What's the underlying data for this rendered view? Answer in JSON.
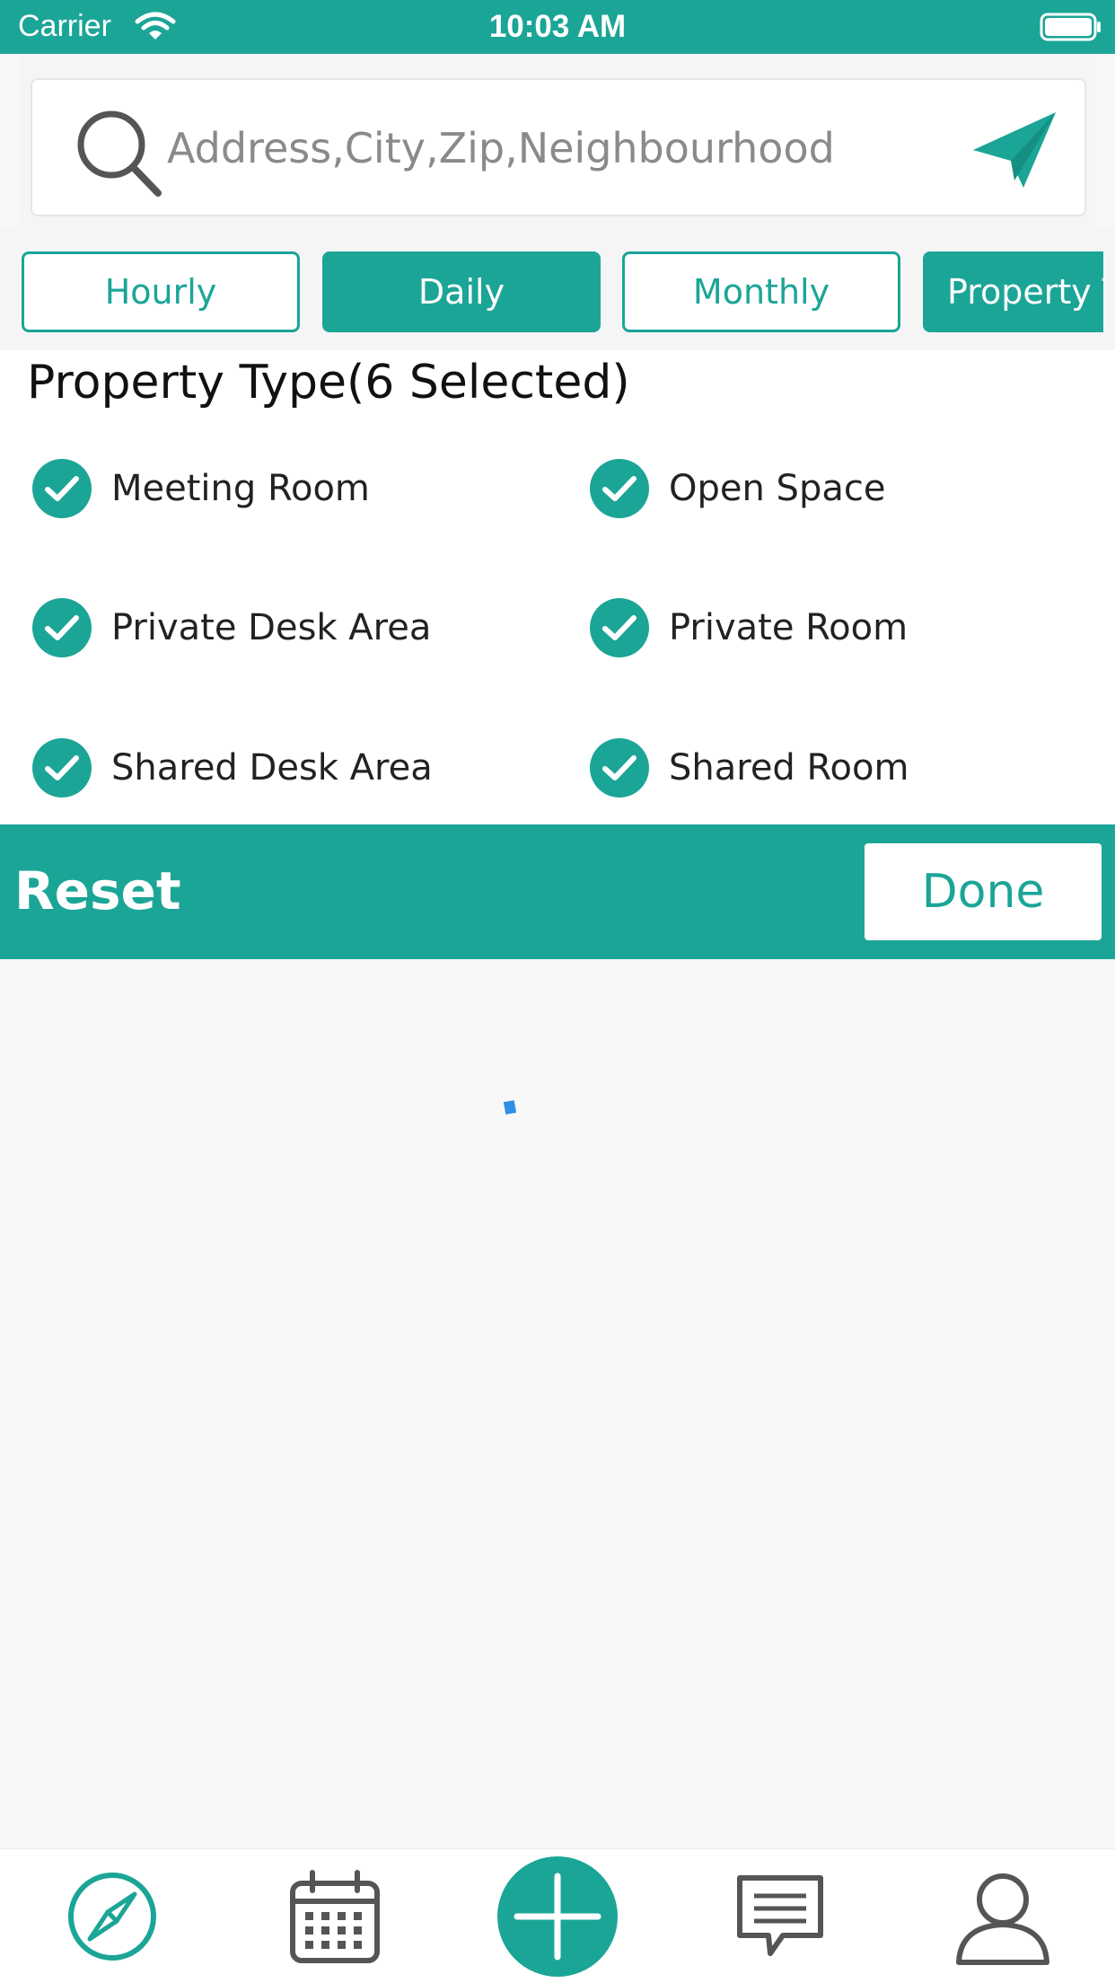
{
  "status_bar": {
    "carrier": "Carrier",
    "time": "10:03 AM"
  },
  "search": {
    "placeholder": "Address,City,Zip,Neighbourhood"
  },
  "tabs": [
    {
      "label": "Hourly",
      "active": false
    },
    {
      "label": "Daily",
      "active": true
    },
    {
      "label": "Monthly",
      "active": false
    },
    {
      "label": "Property T",
      "active": true
    }
  ],
  "property_type": {
    "title": "Property Type(6 Selected)",
    "options": [
      {
        "label": "Meeting Room",
        "checked": true
      },
      {
        "label": "Open Space",
        "checked": true
      },
      {
        "label": "Private Desk Area",
        "checked": true
      },
      {
        "label": "Private Room",
        "checked": true
      },
      {
        "label": "Shared Desk Area",
        "checked": true
      },
      {
        "label": "Shared Room",
        "checked": true
      }
    ]
  },
  "actions": {
    "reset": "Reset",
    "done": "Done"
  },
  "bottom_nav": [
    "compass-icon",
    "calendar-icon",
    "add-icon",
    "chat-icon",
    "profile-icon"
  ],
  "colors": {
    "accent": "#1ba597",
    "spinner": "#2f8fe8"
  }
}
